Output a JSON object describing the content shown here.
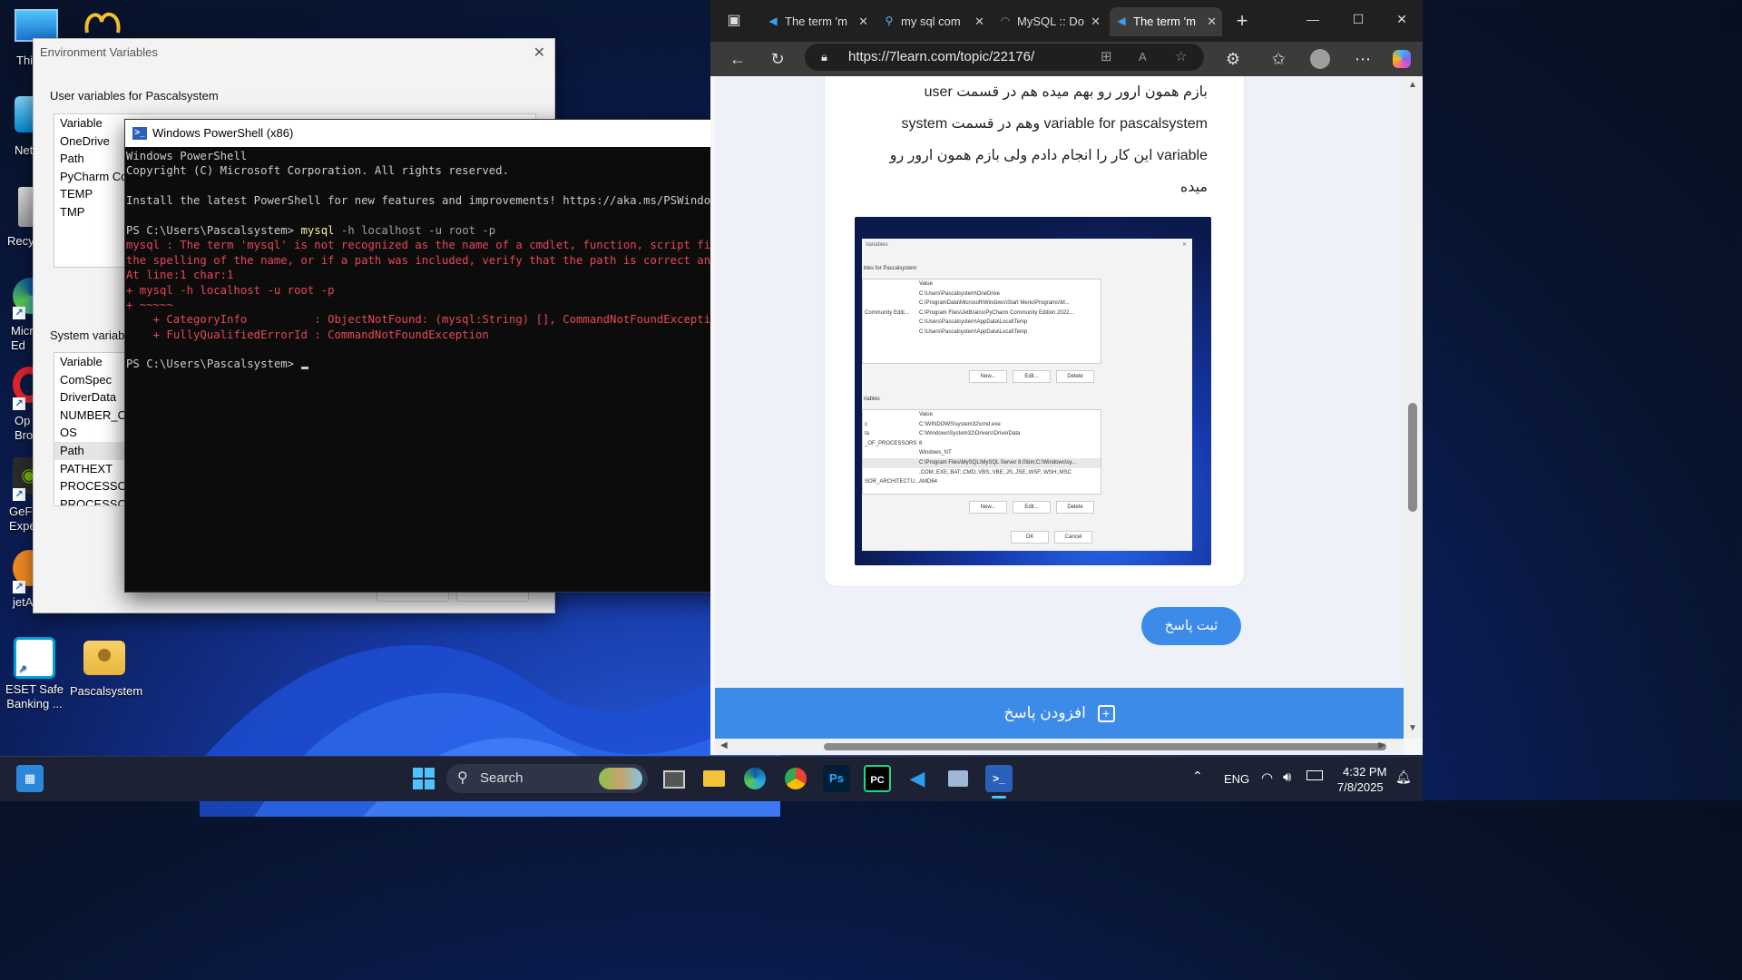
{
  "desktop": {
    "icons": [
      {
        "label": "Thi",
        "name": "this-pc"
      },
      {
        "label": "Net",
        "name": "network"
      },
      {
        "label": "Recy",
        "name": "recycle-bin"
      },
      {
        "label": "Micr Ed",
        "name": "microsoft-edge"
      },
      {
        "label": "Op Bro",
        "name": "opera-browser"
      },
      {
        "label": "GeF Expe",
        "name": "geforce-experience"
      },
      {
        "label": "jetA",
        "name": "jetaudio"
      }
    ],
    "eset_label": "ESET Safe Banking ...",
    "pascal_label": "Pascalsystem"
  },
  "env_dialog": {
    "title": "Environment Variables",
    "user_section": "User variables for Pascalsystem",
    "user_rows": [
      "Variable",
      "OneDrive",
      "Path",
      "PyCharm Com",
      "TEMP",
      "TMP"
    ],
    "system_section": "System variable",
    "system_rows": [
      "Variable",
      "ComSpec",
      "DriverData",
      "NUMBER_OF_",
      "OS",
      "Path",
      "PATHEXT",
      "PROCESSOR_",
      "PROCESSOR"
    ]
  },
  "powershell": {
    "title": "Windows PowerShell (x86)",
    "lines": [
      {
        "t": "Windows PowerShell",
        "c": "n"
      },
      {
        "t": "Copyright (C) Microsoft Corporation. All rights reserved.",
        "c": "n"
      },
      {
        "t": "",
        "c": "n"
      },
      {
        "t": "Install the latest PowerShell for new features and improvements! https://aka.ms/PSWindows",
        "c": "n"
      },
      {
        "t": "",
        "c": "n"
      },
      {
        "t": "PS C:\\Users\\Pascalsystem> ",
        "c": "n",
        "cmd": "mysql",
        "args": " -h localhost -u root -p"
      },
      {
        "t": "mysql : The term 'mysql' is not recognized as the name of a cmdlet, function, script file, or operable program. Check",
        "c": "r"
      },
      {
        "t": "the spelling of the name, or if a path was included, verify that the path is correct and try again.",
        "c": "r"
      },
      {
        "t": "At line:1 char:1",
        "c": "r"
      },
      {
        "t": "+ mysql -h localhost -u root -p",
        "c": "r"
      },
      {
        "t": "+ ~~~~~",
        "c": "r"
      },
      {
        "t": "    + CategoryInfo          : ObjectNotFound: (mysql:String) [], CommandNotFoundException",
        "c": "r"
      },
      {
        "t": "    + FullyQualifiedErrorId : CommandNotFoundException",
        "c": "r"
      },
      {
        "t": "",
        "c": "n"
      },
      {
        "t": "PS C:\\Users\\Pascalsystem> ",
        "c": "n",
        "cursor": true
      }
    ]
  },
  "browser": {
    "tabs": [
      {
        "label": "The term 'm",
        "icon": "vscode-icon"
      },
      {
        "label": "my sql com",
        "icon": "search-icon"
      },
      {
        "label": "MySQL :: Do",
        "icon": "mysql-icon"
      },
      {
        "label": "The term 'm",
        "icon": "vscode-icon",
        "active": true
      }
    ],
    "url": "https://7learn.com/topic/22176/",
    "post_lines": [
      "بازم همون ارور رو بهم میده هم در قسمت user",
      "variable for pascalsystem وهم در قسمت system",
      "variable این کار را انجام دادم ولی بازم همون ارور رو",
      "میده"
    ],
    "submit_label": "ثبت پاسخ",
    "add_answer_label": "افزودن پاسخ",
    "embedded": {
      "title": "Variables",
      "user_section": "bles for Pascalsystem",
      "user_values": [
        "Value",
        "C:\\Users\\Pascalsystem\\OneDrive",
        "C:\\ProgramData\\Microsoft\\Windows\\Start Menu\\Programs\\M...",
        "C:\\Program Files\\JetBrains\\PyCharm Community Edition 2022...",
        "C:\\Users\\Pascalsystem\\AppData\\Local\\Temp",
        "C:\\Users\\Pascalsystem\\AppData\\Local\\Temp"
      ],
      "user_row_prefix": [
        "",
        "",
        "",
        "Community Editi...",
        "",
        ""
      ],
      "system_section": "riables",
      "system_values": [
        "Value",
        "C:\\WINDOWS\\system32\\cmd.exe",
        "C:\\Windows\\System32\\Drivers\\DriverData",
        "8",
        "Windows_NT",
        "C:\\Program Files\\MySQL\\MySQL Server 8.0\\bin;C:\\Windows\\sy...",
        ".COM;.EXE;.BAT;.CMD;.VBS;.VBE;.JS;.JSE;.WSF;.WSH;.MSC",
        "AMD64"
      ],
      "system_row_prefix": [
        "",
        "c",
        "ta",
        "_OF_PROCESSORS",
        "",
        "",
        "",
        "SOR_ARCHITECTU..."
      ],
      "buttons": [
        "New...",
        "Edit...",
        "Delete"
      ],
      "ok": "OK",
      "cancel": "Cancel"
    }
  },
  "taskbar": {
    "search_label": "Search",
    "lang": "ENG",
    "time": "4:32 PM",
    "date": "7/8/2025"
  }
}
